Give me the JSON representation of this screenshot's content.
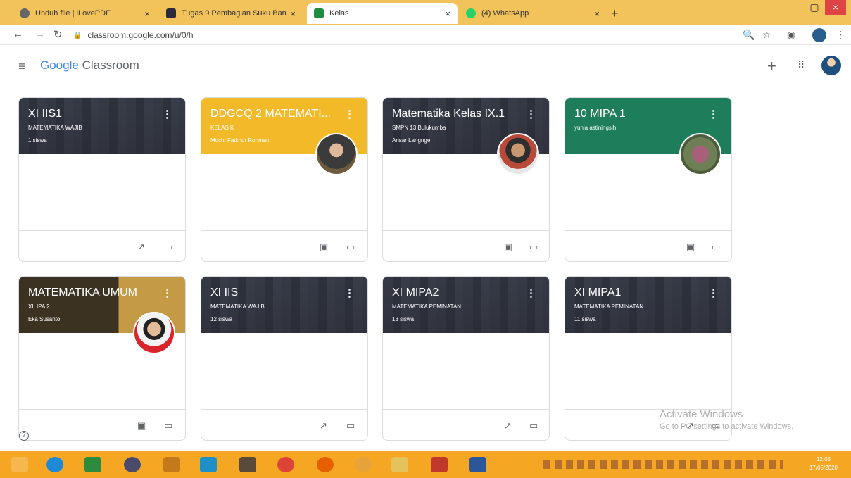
{
  "browser": {
    "tabs": [
      {
        "title": "Unduh file | iLovePDF",
        "close": "×"
      },
      {
        "title": "Tugas 9 Pembagian Suku Banyak",
        "close": "×"
      },
      {
        "title": "Kelas",
        "close": "×"
      },
      {
        "title": "(4) WhatsApp",
        "close": "×"
      }
    ],
    "new_tab": "+",
    "url": "classroom.google.com/u/0/h",
    "win_min": "–",
    "win_max": "▢",
    "win_close": "×"
  },
  "app": {
    "brand_google": "Google",
    "brand_classroom": "Classroom",
    "plus": "+",
    "apps": "⠿"
  },
  "cards": [
    {
      "title": "XI IIS1",
      "sub": "MATEMATIKA WAJIB",
      "third": "1 siswa"
    },
    {
      "title": "DDGCQ 2 MATEMATI...",
      "sub": "KELAS K",
      "third": "Moch. Fatkhur Rohman"
    },
    {
      "title": "Matematika Kelas IX.1",
      "sub": "SMPN 13 Bulukumba",
      "third": "Ansar Langnge"
    },
    {
      "title": "10 MIPA 1",
      "sub": "yunia astiningsih",
      "third": ""
    },
    {
      "title": "MATEMATIKA UMUM",
      "sub": "XII IPA 2",
      "third": "Eka Susanto"
    },
    {
      "title": "XI IIS",
      "sub": "MATEMATIKA WAJIB",
      "third": "12 siswa"
    },
    {
      "title": "XI MIPA2",
      "sub": "MATEMATIKA PEMINATAN",
      "third": "13 siswa"
    },
    {
      "title": "XI MIPA1",
      "sub": "MATEMATIKA PEMINATAN",
      "third": "11 siswa"
    }
  ],
  "watermark": {
    "line1": "Activate Windows",
    "line2": "Go to PC settings to activate Windows."
  },
  "help": "?",
  "clock": {
    "time": "12:05",
    "date": "17/05/2020"
  }
}
